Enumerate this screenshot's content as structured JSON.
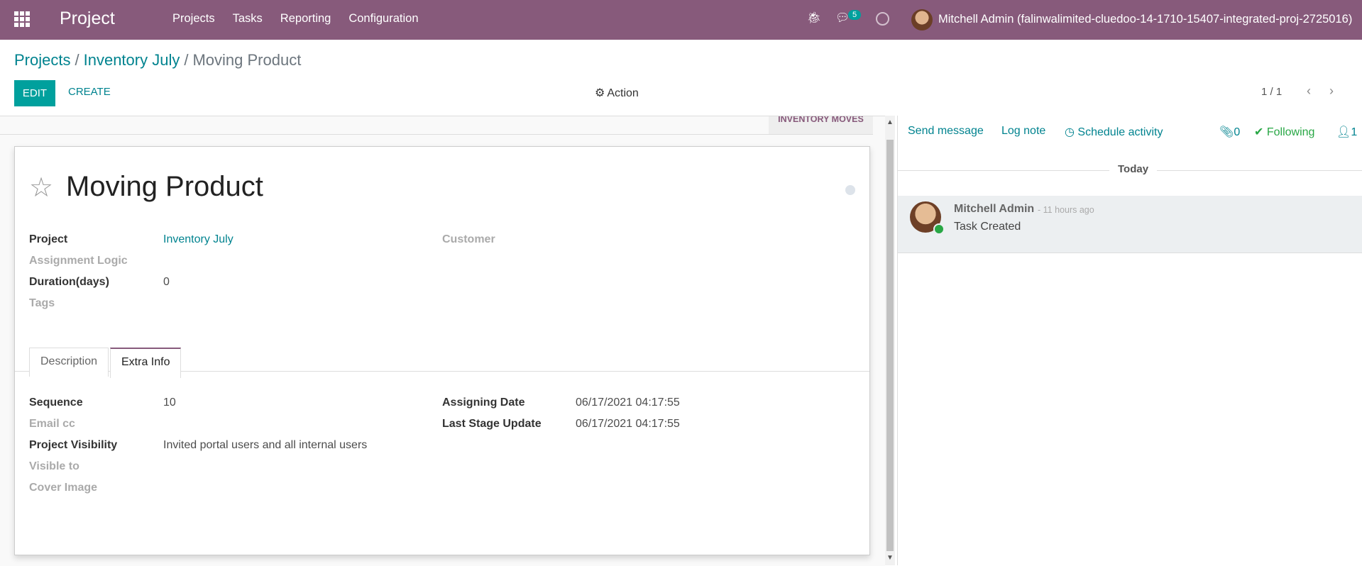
{
  "app": {
    "title": "Project",
    "menu": [
      "Projects",
      "Tasks",
      "Reporting",
      "Configuration"
    ]
  },
  "systray": {
    "chat_count": "5",
    "user": "Mitchell Admin (falinwalimited-cluedoo-14-1710-15407-integrated-proj-2725016)"
  },
  "breadcrumb": {
    "root": "Projects",
    "project": "Inventory July",
    "current": "Moving Product",
    "sep": "/"
  },
  "control": {
    "edit": "EDIT",
    "create": "CREATE",
    "action": "Action",
    "pager": "1 / 1"
  },
  "smart_button": {
    "label": "INVENTORY MOVES"
  },
  "task": {
    "title": "Moving Product",
    "fields_left": [
      {
        "label": "Project",
        "value": "Inventory July"
      },
      {
        "label": "Assignment Logic",
        "value": ""
      },
      {
        "label": "Duration(days)",
        "value": "0"
      },
      {
        "label": "Tags",
        "value": ""
      }
    ],
    "fields_right": [
      {
        "label": "Customer",
        "value": ""
      }
    ]
  },
  "tabs": [
    {
      "label": "Description"
    },
    {
      "label": "Extra Info",
      "active": true
    }
  ],
  "extra_info": {
    "left": [
      {
        "label": "Sequence",
        "value": "10"
      },
      {
        "label": "Email cc",
        "value": ""
      },
      {
        "label": "Project Visibility",
        "value": "Invited portal users and all internal users"
      },
      {
        "label": "Visible to",
        "value": ""
      },
      {
        "label": "Cover Image",
        "value": ""
      }
    ],
    "right": [
      {
        "label": "Assigning Date",
        "value": "06/17/2021 04:17:55"
      },
      {
        "label": "Last Stage Update",
        "value": "06/17/2021 04:17:55"
      }
    ]
  },
  "chatter": {
    "send_message": "Send message",
    "log_note": "Log note",
    "schedule_activity": "Schedule activity",
    "attachments": "0",
    "following": "Following",
    "followers": "1",
    "date_separator": "Today",
    "messages": [
      {
        "author": "Mitchell Admin",
        "time": "- 11 hours ago",
        "body": "Task Created"
      }
    ]
  },
  "colors": {
    "brand": "#875a7b",
    "accent": "#00a09d",
    "link": "#00838f",
    "follow": "#28a745"
  },
  "icons": [
    "apps-icon",
    "bug-icon",
    "chat-icon",
    "clock-icon",
    "gear-icon",
    "star-icon",
    "paperclip-icon",
    "check-icon",
    "user-icon",
    "chevron-left-icon",
    "chevron-right-icon"
  ]
}
